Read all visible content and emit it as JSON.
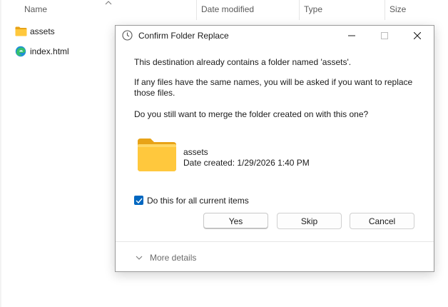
{
  "explorer": {
    "columns": {
      "name": "Name",
      "date_modified": "Date modified",
      "type": "Type",
      "size": "Size"
    },
    "files": [
      {
        "name": "assets",
        "icon": "folder-icon"
      },
      {
        "name": "index.html",
        "icon": "edge-icon"
      }
    ]
  },
  "dialog": {
    "title": "Confirm Folder Replace",
    "line1": "This destination already contains a folder named 'assets'.",
    "line2": "If any files have the same names, you will be asked if you want to replace those files.",
    "line3": "Do you still want to merge the folder created on  with this one?",
    "folder": {
      "name": "assets",
      "date_created": "Date created: 1/29/2026 1:40 PM"
    },
    "checkbox_label": "Do this for all current items",
    "checkbox_checked": true,
    "buttons": {
      "yes": "Yes",
      "skip": "Skip",
      "cancel": "Cancel"
    },
    "more_details": "More details"
  },
  "colors": {
    "accent": "#0067c0",
    "folder_yellow": "#ffc83d"
  }
}
